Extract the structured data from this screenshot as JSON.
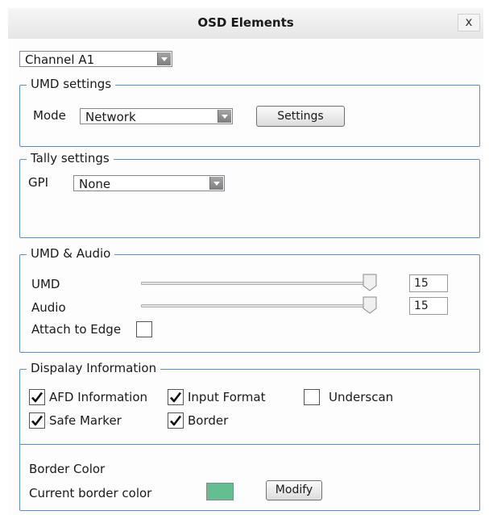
{
  "window": {
    "title": "OSD Elements",
    "close_label": "x"
  },
  "channel_select": {
    "value": "Channel A1"
  },
  "umd_settings": {
    "legend": "UMD settings",
    "mode_label": "Mode",
    "mode_value": "Network",
    "settings_button": "Settings"
  },
  "tally_settings": {
    "legend": "Tally settings",
    "gpi_label": "GPI",
    "gpi_value": "None"
  },
  "umd_audio": {
    "legend": "UMD & Audio",
    "umd_label": "UMD",
    "umd_value": "15",
    "audio_label": "Audio",
    "audio_value": "15",
    "attach_label": "Attach to Edge",
    "attach_checked": false
  },
  "display_info": {
    "legend": "Dispalay Information",
    "afd_label": "AFD Information",
    "afd_checked": true,
    "input_format_label": "Input Format",
    "input_format_checked": true,
    "underscan_label": "Underscan",
    "underscan_checked": false,
    "safe_marker_label": "Safe Marker",
    "safe_marker_checked": true,
    "border_label": "Border",
    "border_checked": true
  },
  "border_color": {
    "heading": "Border Color",
    "current_label": "Current border color",
    "color": "#63bf8f",
    "modify_button": "Modify"
  },
  "colors": {
    "group_border": "#5b8dc7"
  }
}
